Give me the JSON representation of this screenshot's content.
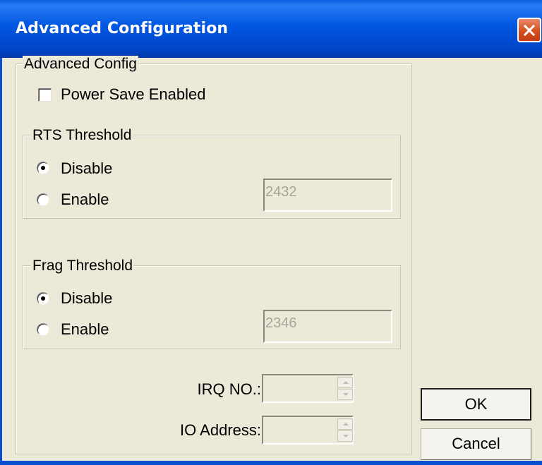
{
  "window": {
    "title": "Advanced Configuration"
  },
  "advanced_config": {
    "legend": "Advanced Config",
    "power_save": {
      "label": "Power Save Enabled",
      "checked": false
    }
  },
  "rts_threshold": {
    "legend": "RTS Threshold",
    "options": [
      {
        "label": "Disable",
        "selected": true
      },
      {
        "label": "Enable",
        "selected": false
      }
    ],
    "value": "2432"
  },
  "frag_threshold": {
    "legend": "Frag Threshold",
    "options": [
      {
        "label": "Disable",
        "selected": true
      },
      {
        "label": "Enable",
        "selected": false
      }
    ],
    "value": "2346"
  },
  "irq": {
    "label": "IRQ NO.:",
    "value": ""
  },
  "io_address": {
    "label": "IO Address:",
    "value": ""
  },
  "buttons": {
    "ok": "OK",
    "cancel": "Cancel"
  },
  "colors": {
    "title_bar": "#0054e3",
    "dialog_bg": "#ece9d8",
    "close_button": "#d6501f"
  }
}
